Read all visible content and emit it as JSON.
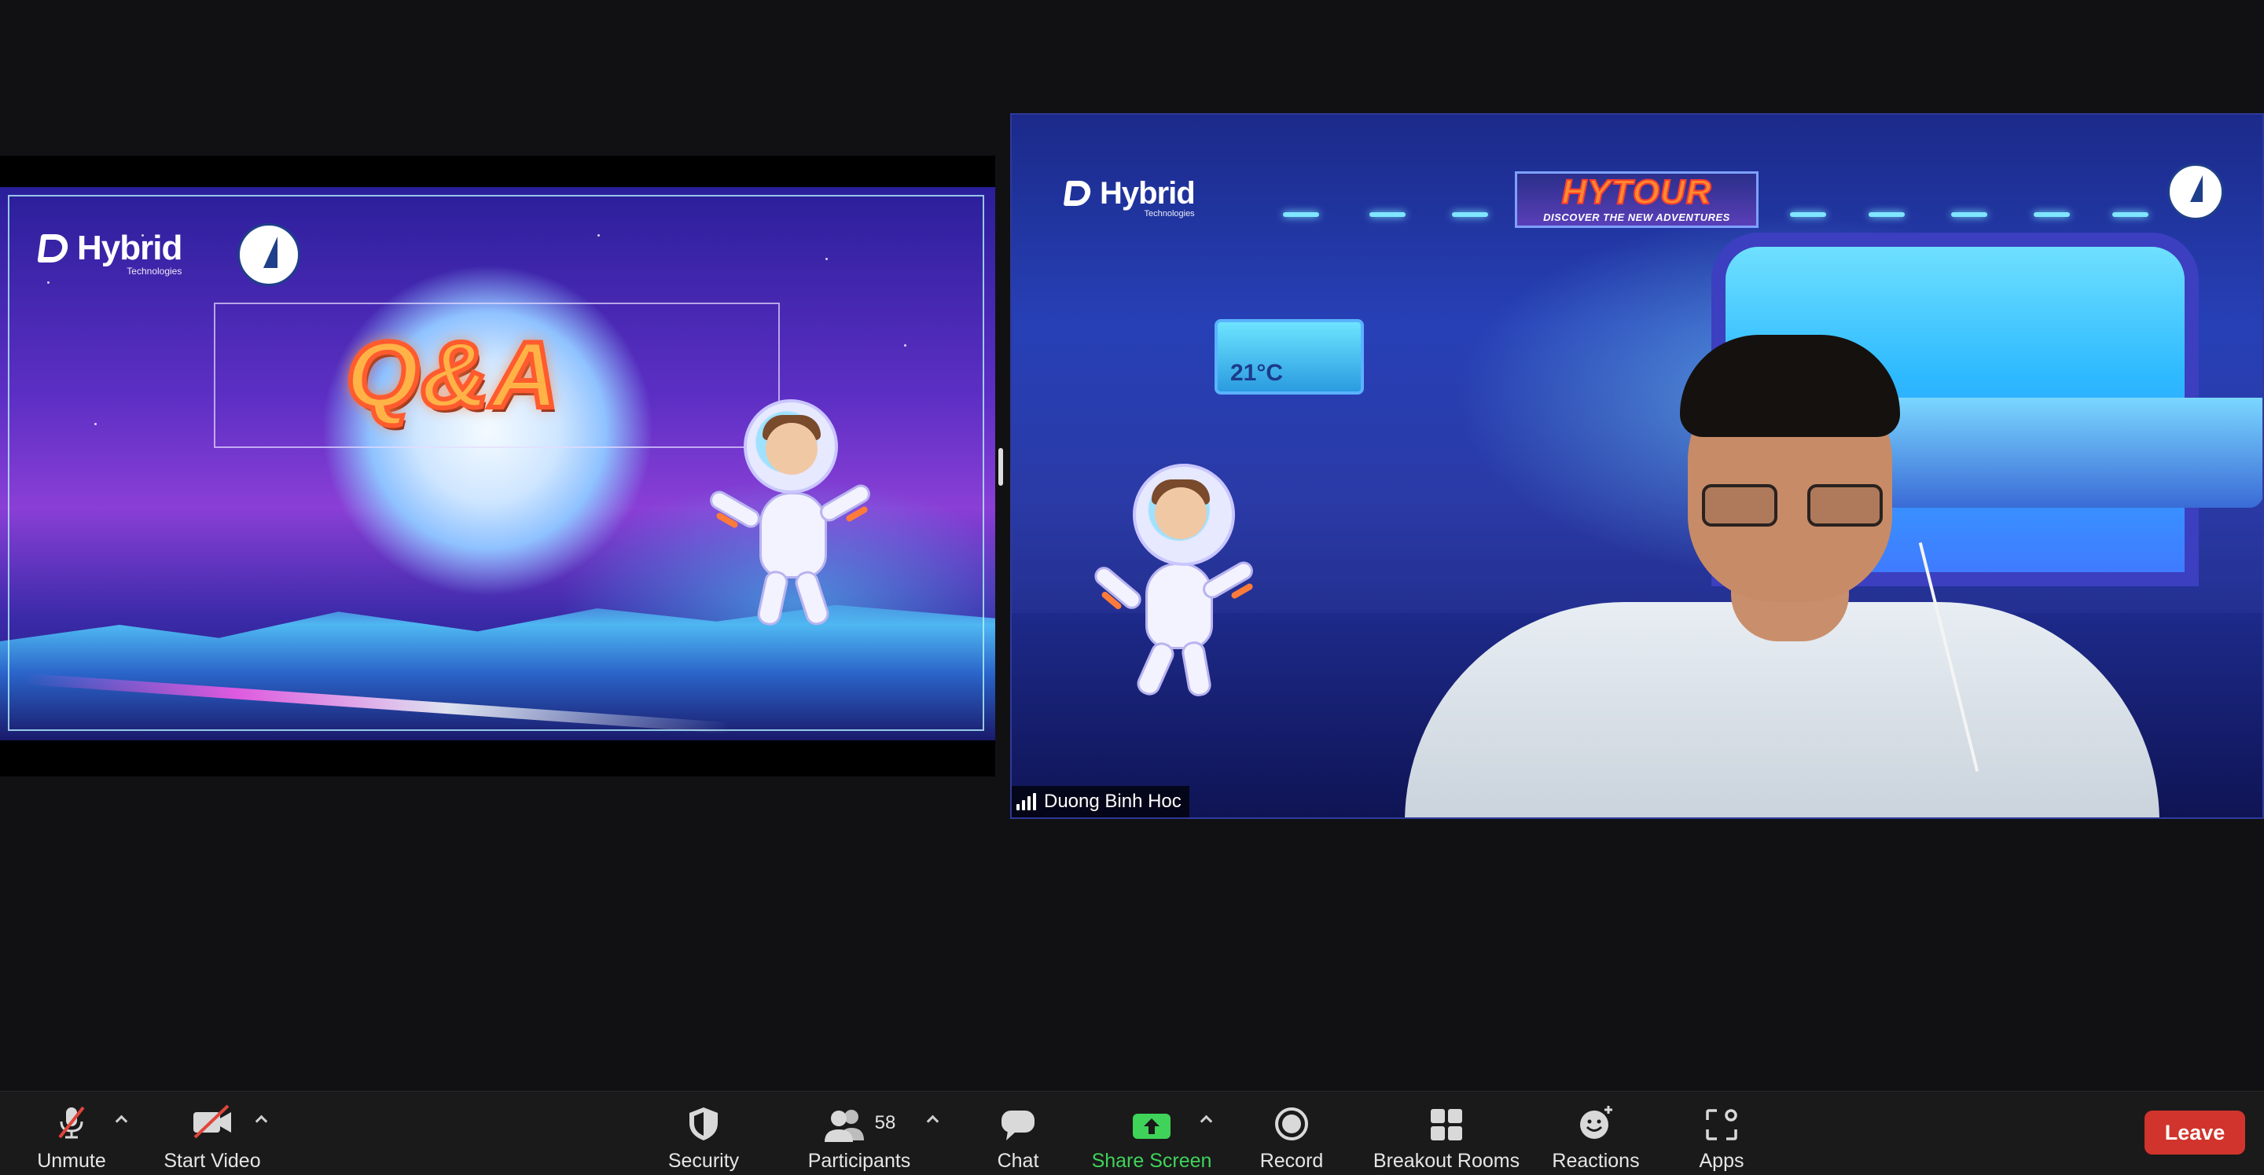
{
  "slide": {
    "logo_text": "Hybrid",
    "logo_sub": "Technologies",
    "title": "Q&A"
  },
  "video": {
    "participant_name": "Duong Binh Hoc",
    "logo_text": "Hybrid",
    "logo_sub": "Technologies",
    "hytour_title": "HYTOUR",
    "hytour_subtitle": "DISCOVER THE NEW ADVENTURES",
    "temperature": "21°C"
  },
  "toolbar": {
    "unmute": {
      "label": "Unmute",
      "icon": "muted-microphone-icon"
    },
    "start_video": {
      "label": "Start Video",
      "icon": "video-off-icon"
    },
    "security": {
      "label": "Security",
      "icon": "shield-icon"
    },
    "participants": {
      "label": "Participants",
      "count": "58",
      "icon": "people-icon"
    },
    "chat": {
      "label": "Chat",
      "icon": "chat-bubble-icon"
    },
    "share_screen": {
      "label": "Share Screen",
      "icon": "share-screen-icon",
      "color": "#3fd35a"
    },
    "record": {
      "label": "Record",
      "icon": "record-icon"
    },
    "breakout_rooms": {
      "label": "Breakout Rooms",
      "icon": "grid-icon"
    },
    "reactions": {
      "label": "Reactions",
      "icon": "smiley-plus-icon"
    },
    "apps": {
      "label": "Apps",
      "icon": "apps-icon"
    },
    "leave": {
      "label": "Leave",
      "color": "#d0342c"
    }
  }
}
